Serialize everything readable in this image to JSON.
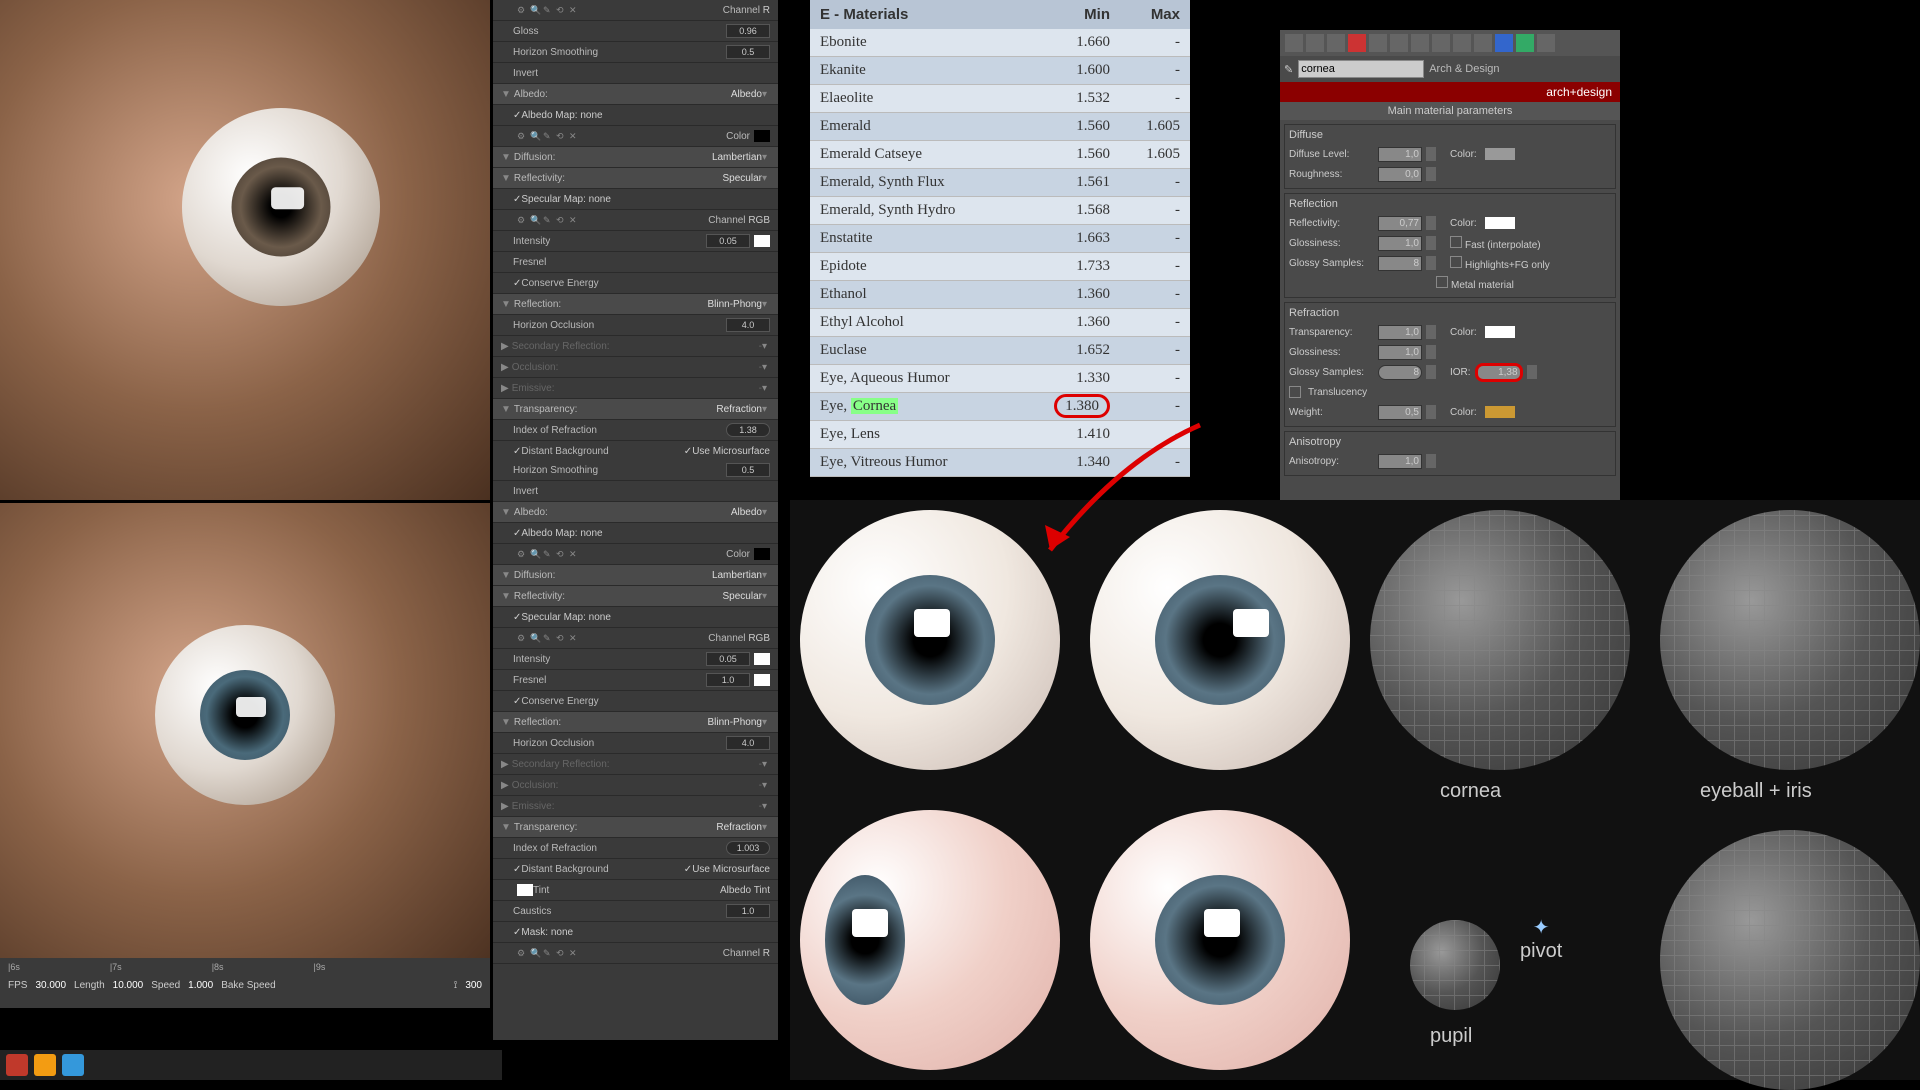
{
  "render_eye_1_desc": "Close-up render of realistic human eye, brown iris, metallic reflection",
  "render_eye_2_desc": "Close-up render of realistic human eye, blue-grey iris",
  "panel1": {
    "gloss": {
      "label": "Gloss",
      "value": "0.96"
    },
    "horizon_smoothing": {
      "label": "Horizon Smoothing",
      "value": "0.5"
    },
    "invert": "Invert",
    "albedo_hdr": {
      "label": "Albedo:",
      "mode": "Albedo"
    },
    "albedo_map": {
      "label": "Albedo Map:",
      "value": "none"
    },
    "color": "Color",
    "diffusion": {
      "label": "Diffusion:",
      "mode": "Lambertian"
    },
    "reflectivity": {
      "label": "Reflectivity:",
      "mode": "Specular"
    },
    "specular_map": {
      "label": "Specular Map:",
      "value": "none"
    },
    "channel": {
      "label": "Channel",
      "value": "RGB"
    },
    "intensity": {
      "label": "Intensity",
      "value": "0.05"
    },
    "fresnel": "Fresnel",
    "conserve": "Conserve Energy",
    "reflection_hdr": {
      "label": "Reflection:",
      "mode": "Blinn-Phong"
    },
    "horizon_occlusion": {
      "label": "Horizon Occlusion",
      "value": "4.0"
    },
    "sec_refl": "Secondary Reflection:",
    "occlusion": "Occlusion:",
    "emissive": "Emissive:",
    "transparency_hdr": {
      "label": "Transparency:",
      "mode": "Refraction"
    },
    "ior": {
      "label": "Index of Refraction",
      "value": "1.38"
    },
    "distant_bg": "Distant Background",
    "use_micro": "Use Microsurface",
    "channel_r": {
      "label": "Channel",
      "value": "R"
    }
  },
  "panel2": {
    "horizon_smoothing": {
      "label": "Horizon Smoothing",
      "value": "0.5"
    },
    "invert": "Invert",
    "albedo_hdr": {
      "label": "Albedo:",
      "mode": "Albedo"
    },
    "albedo_map": {
      "label": "Albedo Map:",
      "value": "none"
    },
    "color": "Color",
    "diffusion": {
      "label": "Diffusion:",
      "mode": "Lambertian"
    },
    "reflectivity": {
      "label": "Reflectivity:",
      "mode": "Specular"
    },
    "specular_map": {
      "label": "Specular Map:",
      "value": "none"
    },
    "channel": {
      "label": "Channel",
      "value": "RGB"
    },
    "intensity": {
      "label": "Intensity",
      "value": "0.05"
    },
    "fresnel": {
      "label": "Fresnel",
      "value": "1.0"
    },
    "conserve": "Conserve Energy",
    "reflection_hdr": {
      "label": "Reflection:",
      "mode": "Blinn-Phong"
    },
    "horizon_occlusion": {
      "label": "Horizon Occlusion",
      "value": "4.0"
    },
    "sec_refl": "Secondary Reflection:",
    "occlusion": "Occlusion:",
    "emissive": "Emissive:",
    "transparency_hdr": {
      "label": "Transparency:",
      "mode": "Refraction"
    },
    "ior": {
      "label": "Index of Refraction",
      "value": "1.003"
    },
    "distant_bg": "Distant Background",
    "use_micro": "Use Microsurface",
    "tint": "Tint",
    "albedo_tint": "Albedo Tint",
    "caustics": {
      "label": "Caustics",
      "value": "1.0"
    },
    "mask": {
      "label": "Mask:",
      "value": "none"
    },
    "channel_r": {
      "label": "Channel",
      "value": "R"
    }
  },
  "materials_table": {
    "header": {
      "c1": "E - Materials",
      "c2": "Min",
      "c3": "Max"
    },
    "rows": [
      {
        "c1": "Ebonite",
        "c2": "1.660",
        "c3": "-"
      },
      {
        "c1": "Ekanite",
        "c2": "1.600",
        "c3": "-"
      },
      {
        "c1": "Elaeolite",
        "c2": "1.532",
        "c3": "-"
      },
      {
        "c1": "Emerald",
        "c2": "1.560",
        "c3": "1.605"
      },
      {
        "c1": "Emerald Catseye",
        "c2": "1.560",
        "c3": "1.605"
      },
      {
        "c1": "Emerald, Synth Flux",
        "c2": "1.561",
        "c3": "-"
      },
      {
        "c1": "Emerald, Synth Hydro",
        "c2": "1.568",
        "c3": "-"
      },
      {
        "c1": "Enstatite",
        "c2": "1.663",
        "c3": "-"
      },
      {
        "c1": "Epidote",
        "c2": "1.733",
        "c3": "-"
      },
      {
        "c1": "Ethanol",
        "c2": "1.360",
        "c3": "-"
      },
      {
        "c1": "Ethyl Alcohol",
        "c2": "1.360",
        "c3": "-"
      },
      {
        "c1": "Euclase",
        "c2": "1.652",
        "c3": "-"
      },
      {
        "c1": "Eye, Aqueous Humor",
        "c2": "1.330",
        "c3": "-"
      },
      {
        "c1a": "Eye, ",
        "c1b": "Cornea",
        "c2": "1.380",
        "c3": "-",
        "highlight": true
      },
      {
        "c1": "Eye, Lens",
        "c2": "1.410",
        "c3": "-"
      },
      {
        "c1": "Eye, Vitreous Humor",
        "c2": "1.340",
        "c3": "-"
      }
    ]
  },
  "arch": {
    "name": "cornea",
    "type": "Arch & Design",
    "brand": "arch+design",
    "title": "Main material parameters",
    "diffuse": {
      "h": "Diffuse",
      "level_l": "Diffuse Level:",
      "level_v": "1,0",
      "rough_l": "Roughness:",
      "rough_v": "0,0",
      "color": "Color:"
    },
    "reflection": {
      "h": "Reflection",
      "refl_l": "Reflectivity:",
      "refl_v": "0,77",
      "gloss_l": "Glossiness:",
      "gloss_v": "1,0",
      "samp_l": "Glossy Samples:",
      "samp_v": "8",
      "color": "Color:",
      "fast": "Fast (interpolate)",
      "hl": "Highlights+FG only",
      "metal": "Metal material"
    },
    "refraction": {
      "h": "Refraction",
      "trans_l": "Transparency:",
      "trans_v": "1,0",
      "gloss_l": "Glossiness:",
      "gloss_v": "1,0",
      "samp_l": "Glossy Samples:",
      "samp_v": "8",
      "color": "Color:",
      "ior_l": "IOR:",
      "ior_v": "1,38",
      "trl": "Translucency",
      "w_l": "Weight:",
      "w_v": "0,5",
      "c2": "Color:"
    },
    "aniso": {
      "h": "Anisotropy",
      "a_l": "Anisotropy:",
      "a_v": "1,0"
    }
  },
  "labels": {
    "cornea": "cornea",
    "eyeball": "eyeball + iris",
    "pivot": "pivot",
    "pupil": "pupil"
  },
  "timeline": {
    "ticks": [
      "|6s",
      "|7s",
      "|8s",
      "|9s"
    ],
    "fps_l": "FPS",
    "fps_v": "30.000",
    "len_l": "Length",
    "len_v": "10.000",
    "spd_l": "Speed",
    "spd_v": "1.000",
    "bake": "Bake Speed",
    "deg": "300"
  }
}
